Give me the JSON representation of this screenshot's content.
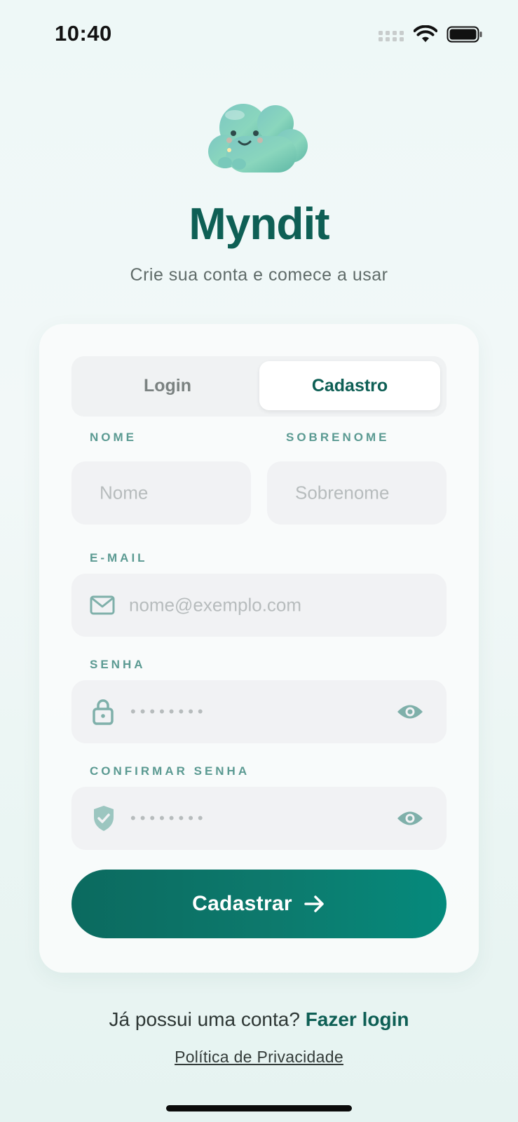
{
  "status": {
    "time": "10:40"
  },
  "brand": {
    "name": "Myndit",
    "subtitle": "Crie sua conta e comece a usar"
  },
  "tabs": [
    {
      "label": "Login",
      "active": false
    },
    {
      "label": "Cadastro",
      "active": true
    }
  ],
  "form": {
    "first_name": {
      "label": "NOME",
      "placeholder": "Nome"
    },
    "last_name": {
      "label": "SOBRENOME",
      "placeholder": "Sobrenome"
    },
    "email": {
      "label": "E-MAIL",
      "placeholder": "nome@exemplo.com",
      "icon": "mail-icon"
    },
    "password": {
      "label": "SENHA",
      "placeholder": "••••••••",
      "icon": "lock-icon"
    },
    "confirm_password": {
      "label": "CONFIRMAR SENHA",
      "placeholder": "••••••••",
      "icon": "shield-check-icon"
    },
    "submit_label": "Cadastrar"
  },
  "footer": {
    "prompt": "Já possui uma conta?",
    "login_link": "Fazer login",
    "privacy": "Política de Privacidade"
  },
  "colors": {
    "brand": "#0e5f55",
    "accent_label": "#5b9a92",
    "button_start": "#0b6a5f",
    "button_end": "#058a7c"
  }
}
